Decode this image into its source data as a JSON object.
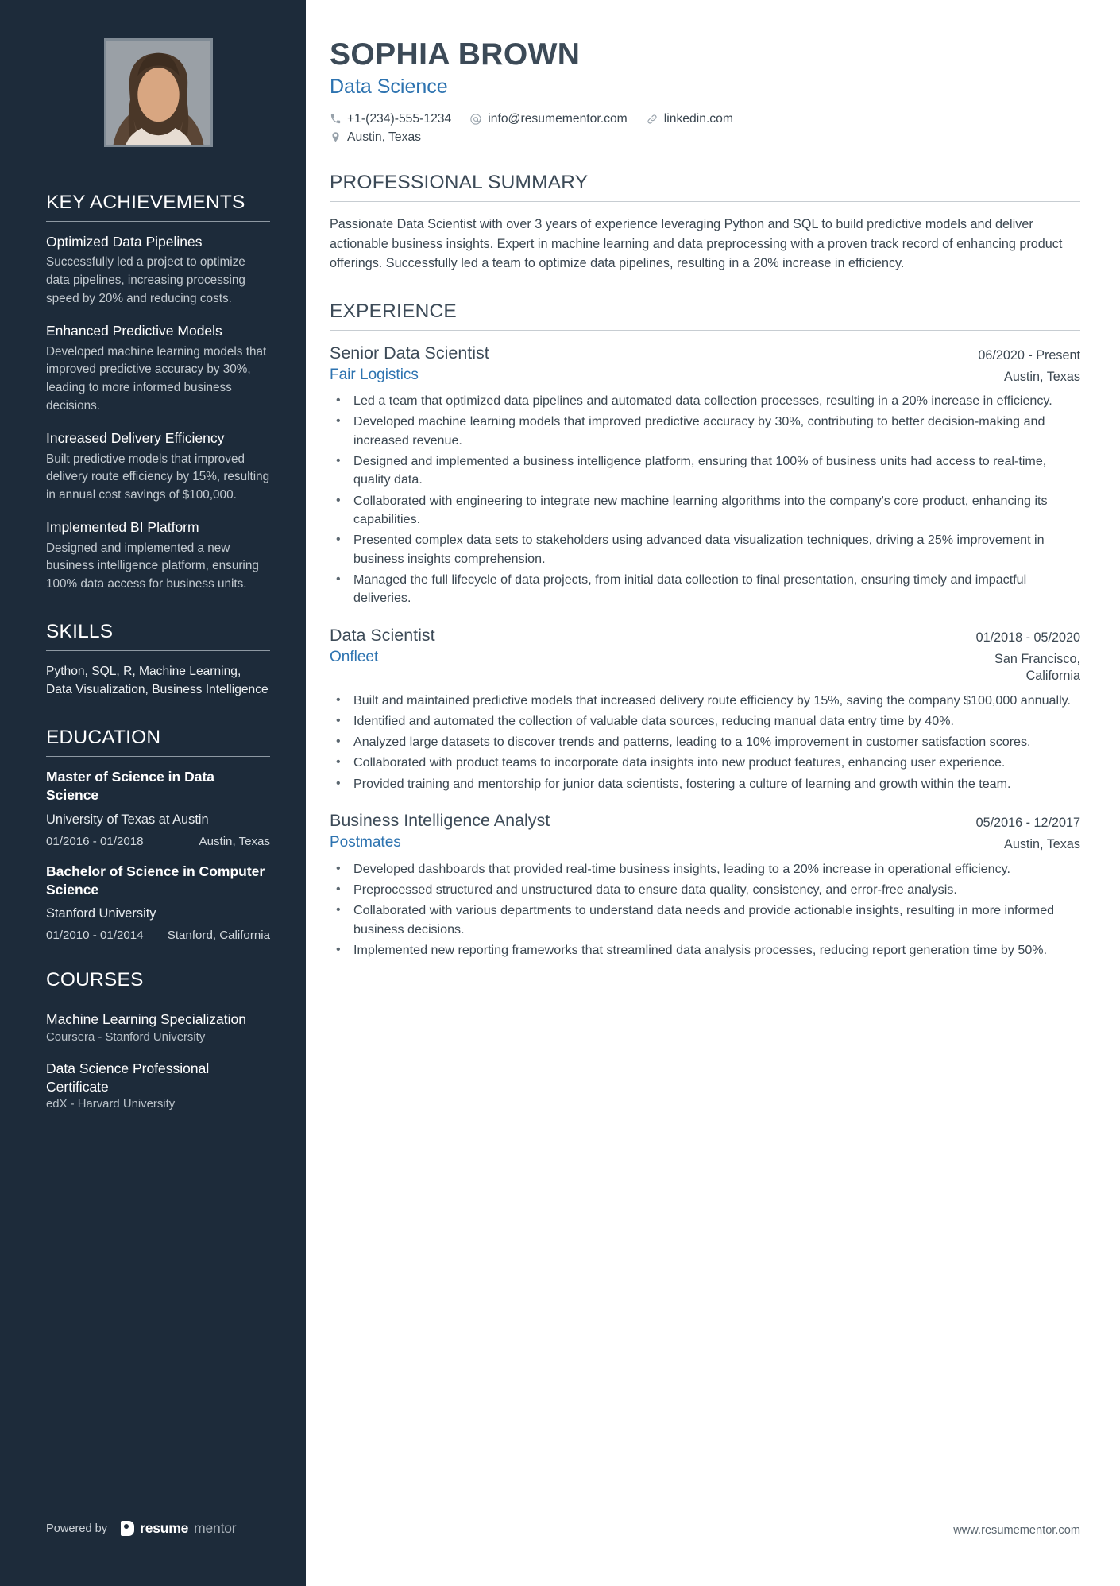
{
  "header": {
    "name": "SOPHIA BROWN",
    "role": "Data Science",
    "phone": "+1-(234)-555-1234",
    "email": "info@resumementor.com",
    "website": "linkedin.com",
    "location": "Austin, Texas",
    "phone_icon": "phone-icon",
    "email_icon": "at-icon",
    "link_icon": "link-icon",
    "location_icon": "map-pin-icon"
  },
  "sidebar": {
    "achievements": {
      "heading": "KEY ACHIEVEMENTS",
      "items": [
        {
          "title": "Optimized Data Pipelines",
          "desc": "Successfully led a project to optimize data pipelines, increasing processing speed by 20% and reducing costs."
        },
        {
          "title": "Enhanced Predictive Models",
          "desc": "Developed machine learning models that improved predictive accuracy by 30%, leading to more informed business decisions."
        },
        {
          "title": "Increased Delivery Efficiency",
          "desc": "Built predictive models that improved delivery route efficiency by 15%, resulting in annual cost savings of $100,000."
        },
        {
          "title": "Implemented BI Platform",
          "desc": "Designed and implemented a new business intelligence platform, ensuring 100% data access for business units."
        }
      ]
    },
    "skills": {
      "heading": "SKILLS",
      "text": "Python, SQL, R, Machine Learning, Data Visualization, Business Intelligence"
    },
    "education": {
      "heading": "EDUCATION",
      "items": [
        {
          "degree": "Master of Science in Data Science",
          "school": "University of Texas at Austin",
          "dates": "01/2016 - 01/2018",
          "location": "Austin, Texas"
        },
        {
          "degree": "Bachelor of Science in Computer Science",
          "school": "Stanford University",
          "dates": "01/2010 - 01/2014",
          "location": "Stanford, California"
        }
      ]
    },
    "courses": {
      "heading": "COURSES",
      "items": [
        {
          "title": "Machine Learning Specialization",
          "provider": "Coursera - Stanford University"
        },
        {
          "title": "Data Science Professional Certificate",
          "provider": "edX - Harvard University"
        }
      ]
    },
    "footer": {
      "powered_by": "Powered by",
      "brand_primary": "resume",
      "brand_secondary": "mentor"
    }
  },
  "main": {
    "summary": {
      "heading": "PROFESSIONAL SUMMARY",
      "text": "Passionate Data Scientist with over 3 years of experience leveraging Python and SQL to build predictive models and deliver actionable business insights. Expert in machine learning and data preprocessing with a proven track record of enhancing product offerings. Successfully led a team to optimize data pipelines, resulting in a 20% increase in efficiency."
    },
    "experience": {
      "heading": "EXPERIENCE",
      "jobs": [
        {
          "title": "Senior Data Scientist",
          "date": "06/2020 - Present",
          "company": "Fair Logistics",
          "location": "Austin, Texas",
          "bullets": [
            "Led a team that optimized data pipelines and automated data collection processes, resulting in a 20% increase in efficiency.",
            "Developed machine learning models that improved predictive accuracy by 30%, contributing to better decision-making and increased revenue.",
            "Designed and implemented a business intelligence platform, ensuring that 100% of business units had access to real-time, quality data.",
            "Collaborated with engineering to integrate new machine learning algorithms into the company's core product, enhancing its capabilities.",
            "Presented complex data sets to stakeholders using advanced data visualization techniques, driving a 25% improvement in business insights comprehension.",
            "Managed the full lifecycle of data projects, from initial data collection to final presentation, ensuring timely and impactful deliveries."
          ]
        },
        {
          "title": "Data Scientist",
          "date": "01/2018 - 05/2020",
          "company": "Onfleet",
          "location": "San Francisco, California",
          "bullets": [
            "Built and maintained predictive models that increased delivery route efficiency by 15%, saving the company $100,000 annually.",
            "Identified and automated the collection of valuable data sources, reducing manual data entry time by 40%.",
            "Analyzed large datasets to discover trends and patterns, leading to a 10% improvement in customer satisfaction scores.",
            "Collaborated with product teams to incorporate data insights into new product features, enhancing user experience.",
            "Provided training and mentorship for junior data scientists, fostering a culture of learning and growth within the team."
          ]
        },
        {
          "title": "Business Intelligence Analyst",
          "date": "05/2016 - 12/2017",
          "company": "Postmates",
          "location": "Austin, Texas",
          "bullets": [
            "Developed dashboards that provided real-time business insights, leading to a 20% increase in operational efficiency.",
            "Preprocessed structured and unstructured data to ensure data quality, consistency, and error-free analysis.",
            "Collaborated with various departments to understand data needs and provide actionable insights, resulting in more informed business decisions.",
            "Implemented new reporting frameworks that streamlined data analysis processes, reducing report generation time by 50%."
          ]
        }
      ]
    },
    "footer_url": "www.resumementor.com"
  },
  "colors": {
    "sidebar_bg": "#1d2b3a",
    "accent_blue": "#2d73b0",
    "heading_dark": "#3c4a57"
  }
}
